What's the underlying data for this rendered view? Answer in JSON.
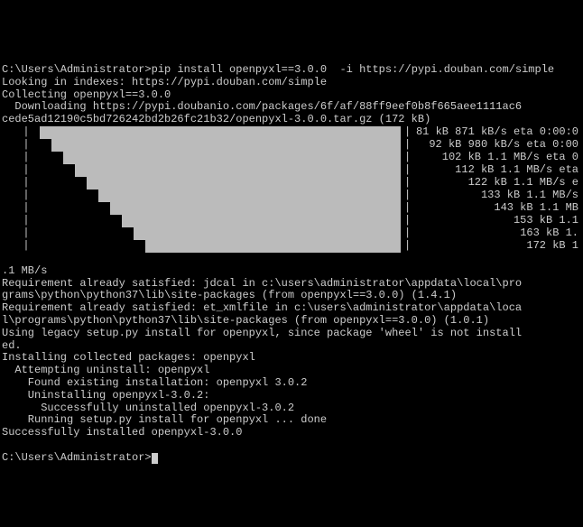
{
  "prompt1_path": "C:\\Users\\Administrator>",
  "command": "pip install openpyxl==3.0.0  -i https://pypi.douban.com/simple",
  "line_looking": "Looking in indexes: https://pypi.douban.com/simple",
  "line_collecting": "Collecting openpyxl==3.0.0",
  "line_downloading1": "  Downloading https://pypi.doubanio.com/packages/6f/af/88ff9eef0b8f665aee1111ac6",
  "line_downloading2": "cede5ad12190c5bd726242bd2b26fc21b32/openpyxl-3.0.0.tar.gz (172 kB)",
  "progress_rows": [
    {
      "fill": 0,
      "text": "81 kB 871 kB/s eta 0:00:0"
    },
    {
      "fill": 1,
      "text": "92 kB 980 kB/s eta 0:00"
    },
    {
      "fill": 2,
      "text": "102 kB 1.1 MB/s eta 0"
    },
    {
      "fill": 3,
      "text": "112 kB 1.1 MB/s eta"
    },
    {
      "fill": 4,
      "text": "122 kB 1.1 MB/s e"
    },
    {
      "fill": 5,
      "text": "133 kB 1.1 MB/s"
    },
    {
      "fill": 6,
      "text": "143 kB 1.1 MB"
    },
    {
      "fill": 7,
      "text": "153 kB 1.1 "
    },
    {
      "fill": 8,
      "text": "163 kB 1. "
    },
    {
      "fill": 9,
      "text": "172 kB 1 "
    }
  ],
  "line_mbs": ".1 MB/s",
  "line_req1": "Requirement already satisfied: jdcal in c:\\users\\administrator\\appdata\\local\\pro",
  "line_req1b": "grams\\python\\python37\\lib\\site-packages (from openpyxl==3.0.0) (1.4.1)",
  "line_req2": "Requirement already satisfied: et_xmlfile in c:\\users\\administrator\\appdata\\loca",
  "line_req2b": "l\\programs\\python\\python37\\lib\\site-packages (from openpyxl==3.0.0) (1.0.1)",
  "line_legacy": "Using legacy setup.py install for openpyxl, since package 'wheel' is not install",
  "line_legacy2": "ed.",
  "line_installing": "Installing collected packages: openpyxl",
  "line_attempting": "  Attempting uninstall: openpyxl",
  "line_found": "    Found existing installation: openpyxl 3.0.2",
  "line_uninstalling": "    Uninstalling openpyxl-3.0.2:",
  "line_success_uninstall": "      Successfully uninstalled openpyxl-3.0.2",
  "line_running": "    Running setup.py install for openpyxl ... done",
  "line_success": "Successfully installed openpyxl-3.0.0",
  "blank": "",
  "prompt2_path": "C:\\Users\\Administrator>"
}
